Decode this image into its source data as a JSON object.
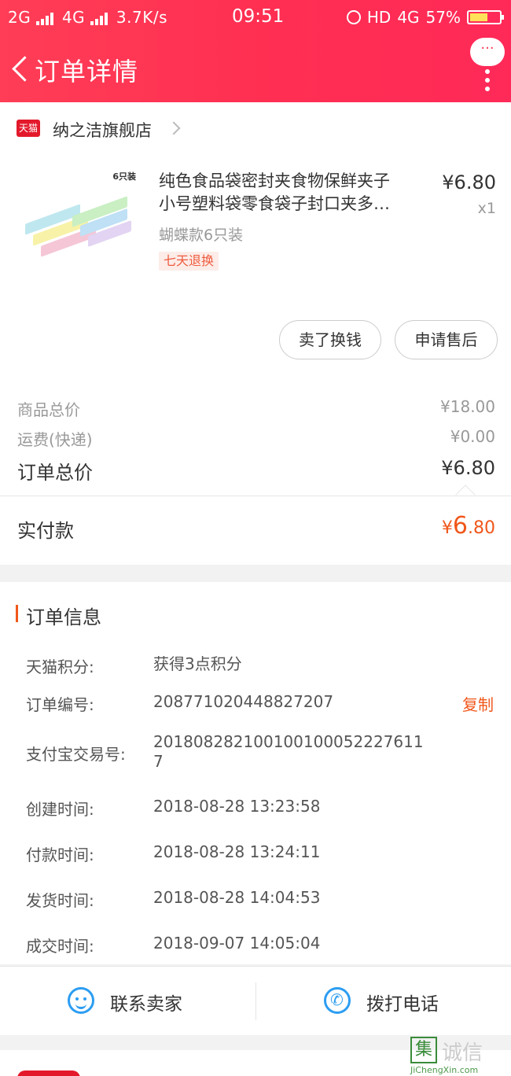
{
  "status_bar": {
    "network": "2G",
    "network2": "4G",
    "speed": "3.7K/s",
    "time": "09:51",
    "hd": "HD",
    "network3": "4G",
    "battery": "57%"
  },
  "nav": {
    "title": "订单详情",
    "more_label": "···"
  },
  "store": {
    "badge": "天猫",
    "name": "纳之洁旗舰店"
  },
  "product": {
    "image_tag": "6只装",
    "title_line1": "纯色食品袋密封夹食物保鲜夹子",
    "title_line2": "小号塑料袋零食袋子封口夹多…",
    "price": "¥6.80",
    "qty": "x1",
    "variant": "蝴蝶款6只装",
    "return_badge": "七天退换"
  },
  "buttons": {
    "sell": "卖了换钱",
    "after_sale": "申请售后"
  },
  "summary": {
    "goods_label": "商品总价",
    "goods_value": "¥18.00",
    "shipping_label": "运费(快递)",
    "shipping_value": "¥0.00",
    "total_label": "订单总价",
    "total_value": "¥6.80",
    "paid_label": "实付款",
    "paid_yen": "¥",
    "paid_int": "6",
    "paid_dec": ".80"
  },
  "order_info": {
    "heading": "订单信息",
    "copy_label": "复制",
    "rows": [
      {
        "label": "天猫积分:",
        "value": "获得3点积分"
      },
      {
        "label": "订单编号:",
        "value": "208771020448827207"
      },
      {
        "label": "支付宝交易号:",
        "value": "2018082821001001000522276117"
      },
      {
        "label": "创建时间:",
        "value": "2018-08-28 13:23:58"
      },
      {
        "label": "付款时间:",
        "value": "2018-08-28 13:24:11"
      },
      {
        "label": "发货时间:",
        "value": "2018-08-28 14:04:53"
      },
      {
        "label": "成交时间:",
        "value": "2018-09-07 14:05:04"
      }
    ]
  },
  "actions": {
    "contact": "联系卖家",
    "call": "拨打电话"
  },
  "watermark": {
    "icon": "集",
    "text": "诚信",
    "url": "JiChengXin.com"
  },
  "colors": {
    "brand_red": "#ff3d56",
    "accent_orange": "#f0571b",
    "icon_blue": "#2c9df2"
  }
}
